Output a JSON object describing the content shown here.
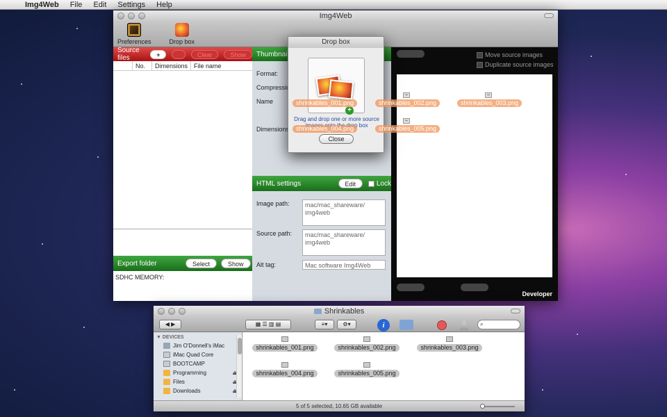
{
  "menubar": {
    "app_name": "Img4Web",
    "items": [
      "File",
      "Edit",
      "Settings",
      "Help"
    ]
  },
  "main_window": {
    "title": "Img4Web",
    "toolbar": {
      "preferences_label": "Preferences",
      "dropbox_label": "Drop box"
    },
    "source_files": {
      "title": "Source files",
      "add_label": "+",
      "clear_label": "Clear",
      "show_label": "Show",
      "columns": [
        "No.",
        "Dimensions",
        "File name"
      ]
    },
    "export_folder": {
      "title": "Export folder",
      "select_label": "Select",
      "show_label": "Show",
      "value": "SDHC MEMORY:"
    },
    "thumbnail": {
      "title": "Thumbnail",
      "fields": [
        "Format:",
        "Compression",
        "Name",
        "Dimensions"
      ]
    },
    "html_settings": {
      "title": "HTML settings",
      "edit_label": "Edit",
      "lock_label": "Lock",
      "image_path_label": "Image path:",
      "image_path_value": "mac/mac_shareware/ img4web",
      "source_path_label": "Source path:",
      "source_path_value": "mac/mac_shareware/ img4web",
      "alt_tag_label": "Alt tag:",
      "alt_tag_value": "Mac software Img4Web"
    },
    "right_panel": {
      "move_source_label": "Move source images",
      "duplicate_source_label": "Duplicate source images",
      "developer_label": "Developer"
    }
  },
  "drop_box": {
    "title": "Drop box",
    "message": "Drag and drop one or more source images onto the drop box",
    "close_label": "Close"
  },
  "dragged_files": [
    "shrinkables_001.png",
    "shrinkables_002.png",
    "shrinkables_003.png",
    "shrinkables_004.png",
    "shrinkables_005.png"
  ],
  "finder": {
    "title": "Shrinkables",
    "devices_header": "DEVICES",
    "devices": [
      {
        "name": "Jim O'Donnell's iMac",
        "icon": "imac-icon"
      },
      {
        "name": "iMac Quad Core",
        "icon": "disk-icon"
      },
      {
        "name": "BOOTCAMP",
        "icon": "disk-icon"
      },
      {
        "name": "Programming",
        "icon": "folder-icon",
        "eject": "⏏"
      },
      {
        "name": "Files",
        "icon": "folder-icon",
        "eject": "⏏"
      },
      {
        "name": "Downloads",
        "icon": "folder-icon",
        "eject": "⏏"
      }
    ],
    "files": [
      "shrinkables_001.png",
      "shrinkables_002.png",
      "shrinkables_003.png",
      "shrinkables_004.png",
      "shrinkables_005.png"
    ],
    "status": "5 of 5 selected, 10.65 GB available",
    "info_glyph": "i"
  }
}
